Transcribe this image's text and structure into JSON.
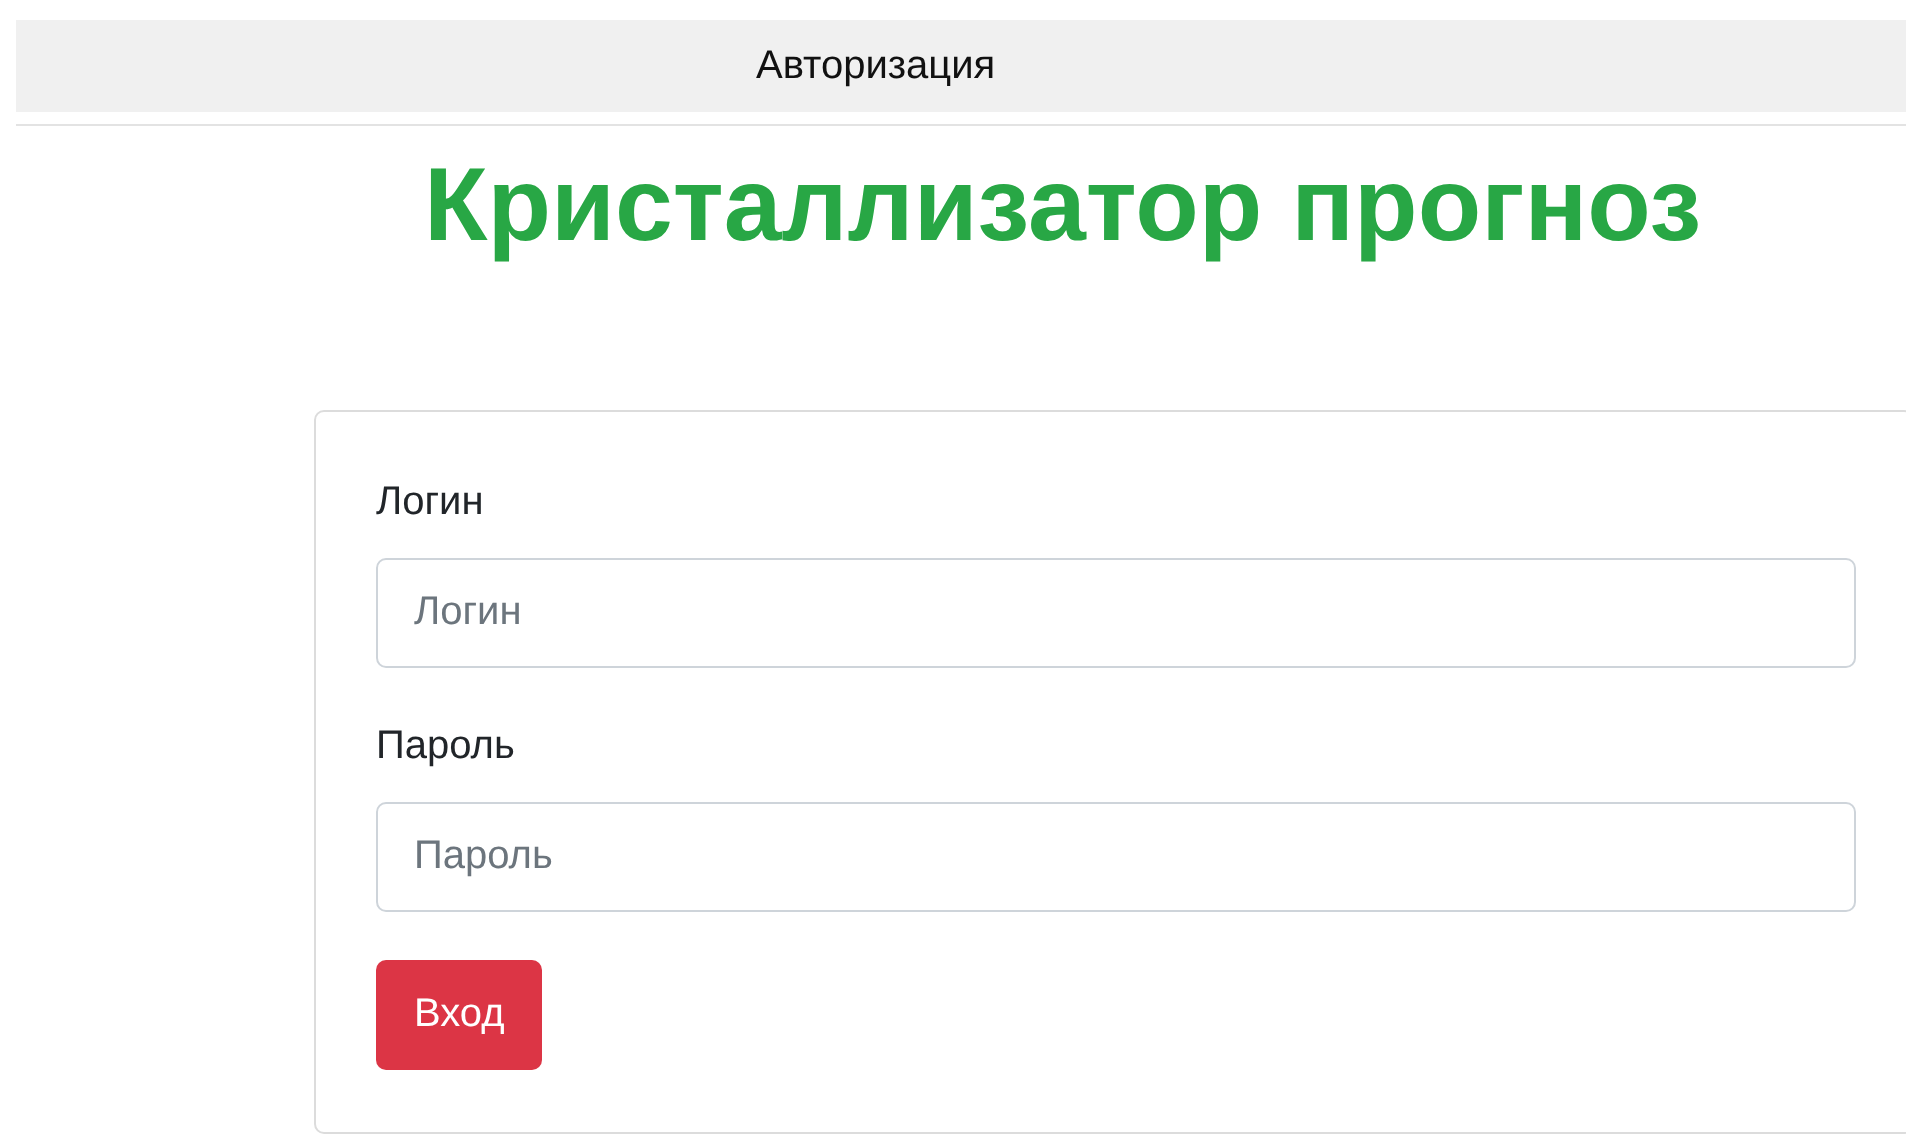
{
  "header": {
    "title": "Авторизация"
  },
  "heading": "Кристаллизатор прогноз",
  "form": {
    "fields": [
      {
        "label": "Логин",
        "placeholder": "Логин"
      },
      {
        "label": "Пароль",
        "placeholder": "Пароль"
      }
    ],
    "submit": "Вход"
  }
}
